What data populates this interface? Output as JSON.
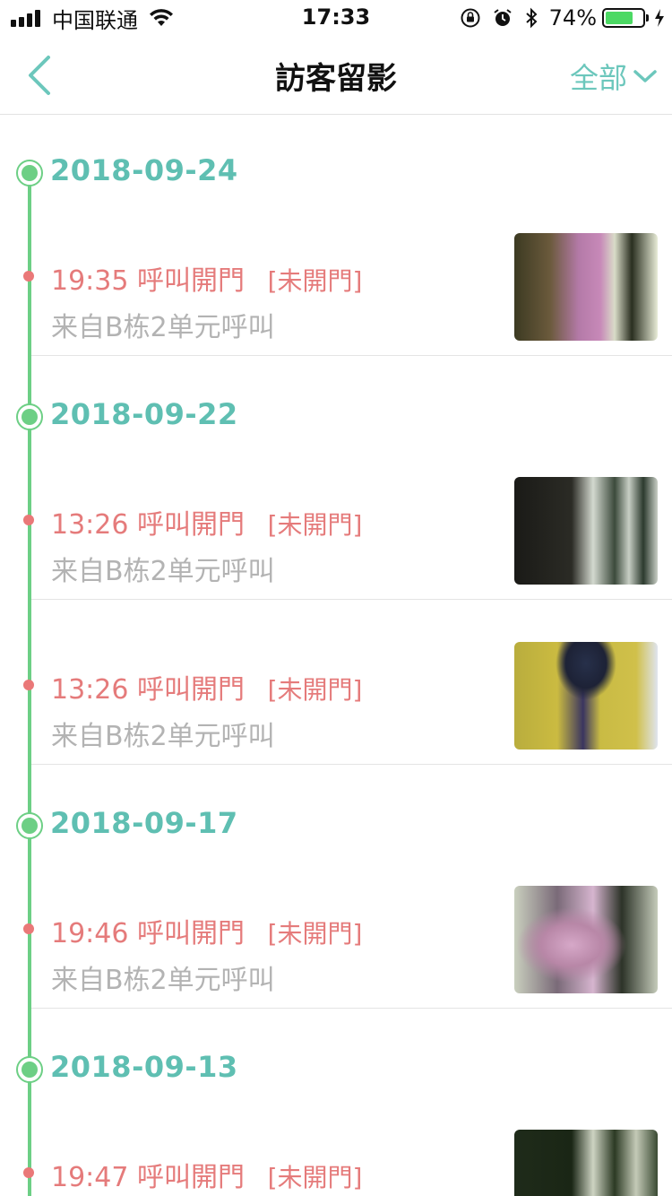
{
  "status_bar": {
    "carrier": "中国联通",
    "time": "17:33",
    "battery_percent": "74%",
    "battery_level": 0.74,
    "icons": [
      "signal-icon",
      "wifi-icon",
      "orientation-lock-icon",
      "alarm-icon",
      "bluetooth-icon",
      "battery-icon",
      "charging-icon"
    ]
  },
  "nav": {
    "back_icon": "chevron-left-icon",
    "title": "訪客留影",
    "filter_label": "全部",
    "filter_icon": "chevron-down-icon"
  },
  "colors": {
    "accent_teal": "#5fbfb2",
    "timeline_green": "#6dcf85",
    "missed_red": "#e57b7b",
    "subtitle_gray": "#b3b3b3"
  },
  "groups": [
    {
      "date": "2018-09-24",
      "items": [
        {
          "time": "19:35",
          "action": "呼叫開門",
          "status": "[未開門]",
          "source": "来自B栋2单元呼叫"
        }
      ]
    },
    {
      "date": "2018-09-22",
      "items": [
        {
          "time": "13:26",
          "action": "呼叫開門",
          "status": "[未開門]",
          "source": "来自B栋2单元呼叫"
        },
        {
          "time": "13:26",
          "action": "呼叫開門",
          "status": "[未開門]",
          "source": "来自B栋2单元呼叫"
        }
      ]
    },
    {
      "date": "2018-09-17",
      "items": [
        {
          "time": "19:46",
          "action": "呼叫開門",
          "status": "[未開門]",
          "source": "来自B栋2单元呼叫"
        }
      ]
    },
    {
      "date": "2018-09-13",
      "items": [
        {
          "time": "19:47",
          "action": "呼叫開門",
          "status": "[未開門]",
          "source": ""
        }
      ]
    }
  ]
}
